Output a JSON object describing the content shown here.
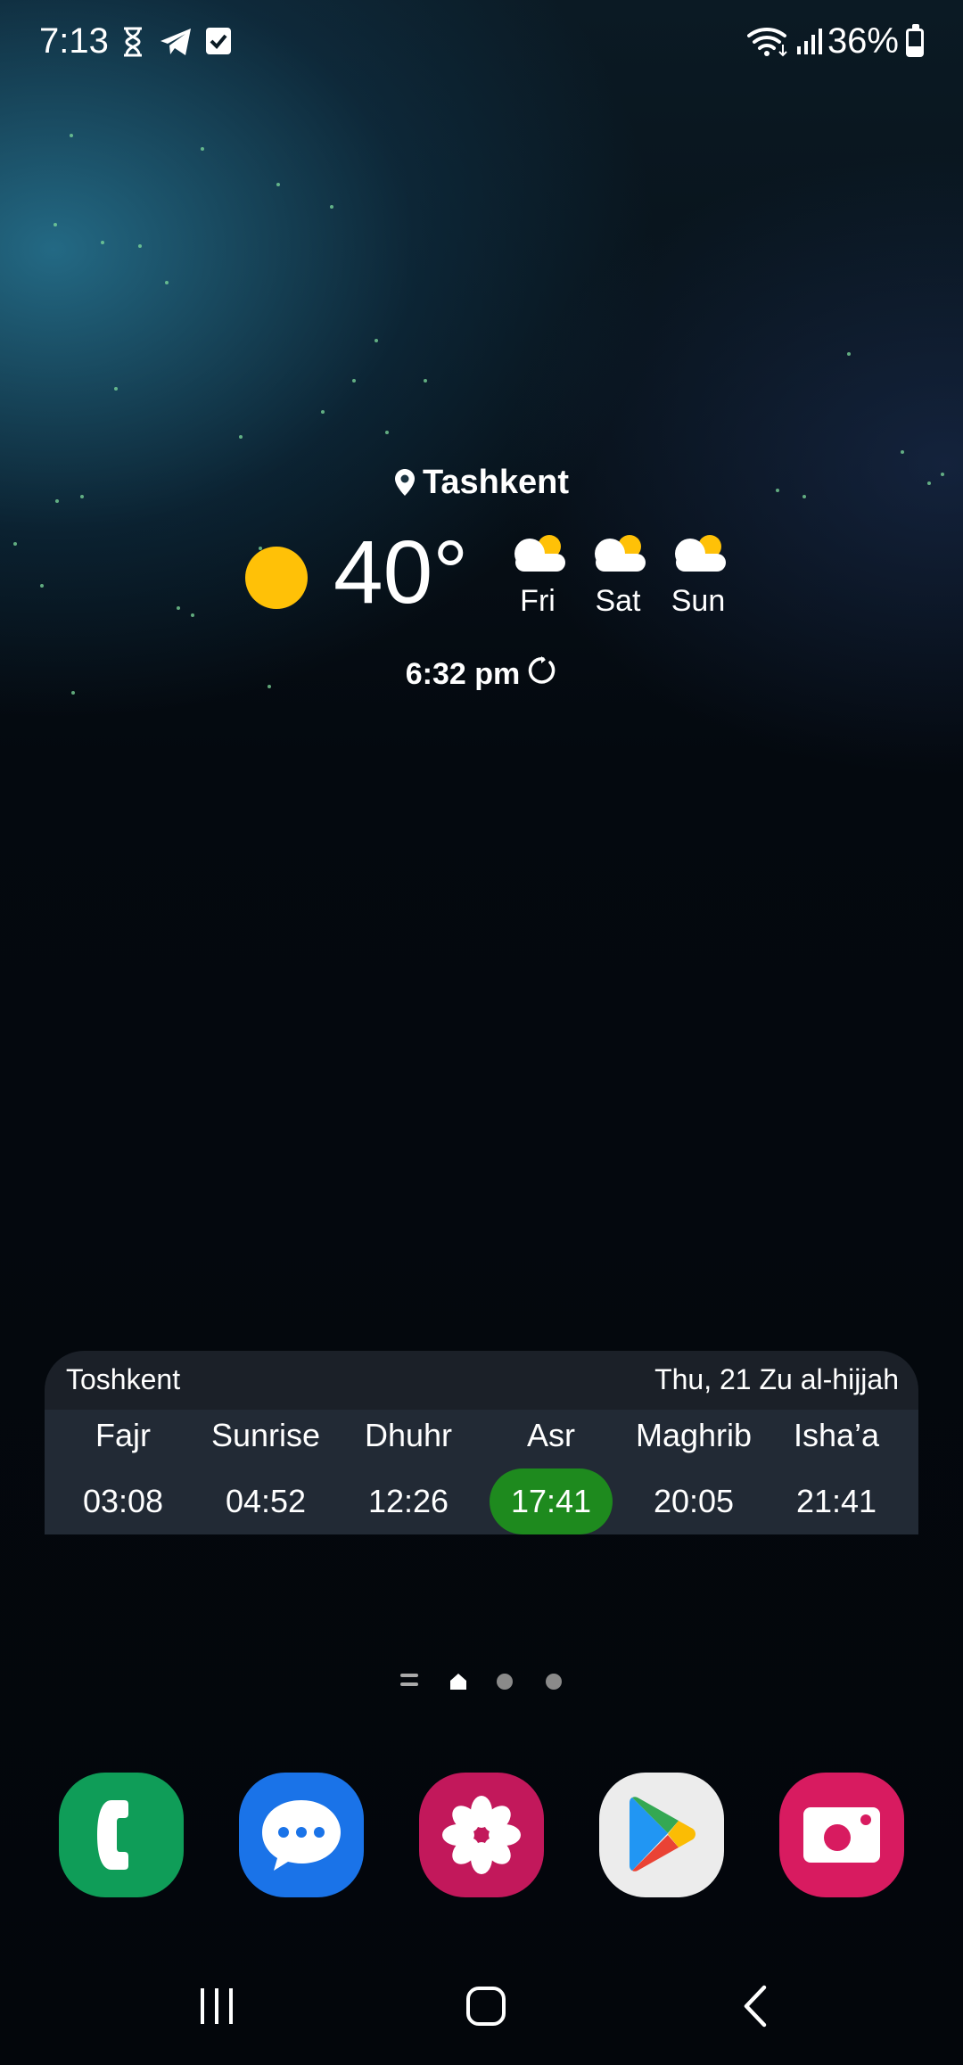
{
  "status_bar": {
    "time": "7:13",
    "battery": "36%",
    "battery_level": 0.36,
    "left_icons": [
      "hourglass-icon",
      "telegram-icon",
      "checkbox-icon"
    ],
    "right_icons": [
      "wifi-icon",
      "signal-icon",
      "battery-icon"
    ]
  },
  "weather": {
    "location": "Tashkent",
    "temperature": "40°",
    "current_icon": "sun-icon",
    "forecast": [
      {
        "day": "Fri",
        "icon": "partly-cloudy-icon"
      },
      {
        "day": "Sat",
        "icon": "partly-cloudy-icon"
      },
      {
        "day": "Sun",
        "icon": "partly-cloudy-icon"
      }
    ],
    "updated": "6:32 pm"
  },
  "prayer": {
    "city": "Toshkent",
    "date": "Thu, 21 Zu al-hijjah",
    "times": [
      {
        "name": "Fajr",
        "time": "03:08"
      },
      {
        "name": "Sunrise",
        "time": "04:52"
      },
      {
        "name": "Dhuhr",
        "time": "12:26"
      },
      {
        "name": "Asr",
        "time": "17:41",
        "active": true
      },
      {
        "name": "Maghrib",
        "time": "20:05"
      },
      {
        "name": "Isha’a",
        "time": "21:41"
      }
    ],
    "active_color": "#1e8a1e"
  },
  "dock": [
    {
      "name": "phone",
      "icon": "phone-icon",
      "color": "#0f9d58"
    },
    {
      "name": "messages",
      "icon": "chat-icon",
      "color": "#1a73e8"
    },
    {
      "name": "gallery",
      "icon": "flower-icon",
      "color": "#c2185b"
    },
    {
      "name": "play-store",
      "icon": "play-store-icon",
      "color": "#ececec"
    },
    {
      "name": "camera",
      "icon": "camera-icon",
      "color": "#d81b60"
    }
  ],
  "page_indicator": {
    "pages": 3,
    "current": "home"
  },
  "nav_bar": [
    "recents-icon",
    "home-icon",
    "back-icon"
  ]
}
